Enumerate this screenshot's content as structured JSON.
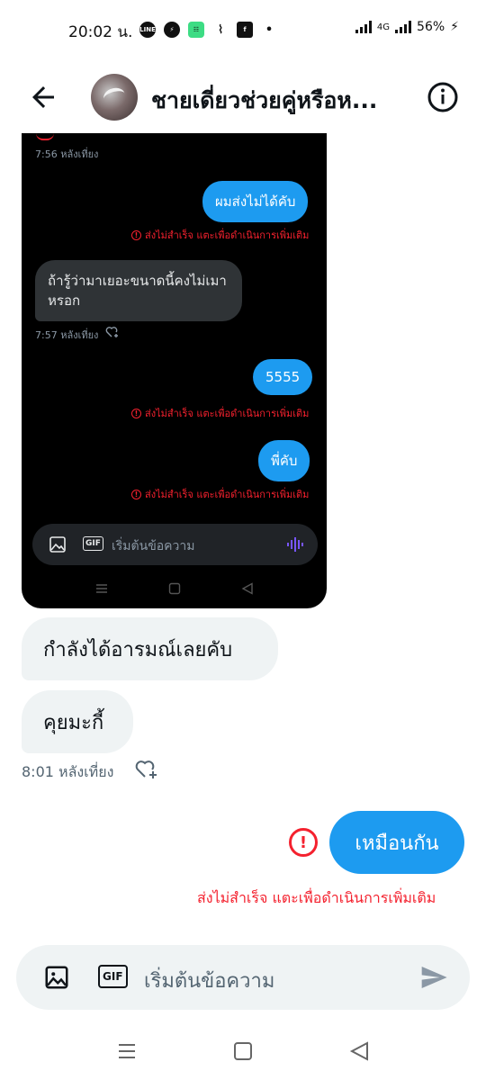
{
  "status_bar": {
    "time": "20:02 น.",
    "battery": "56%",
    "network": "4G",
    "icons": [
      "line-icon",
      "messenger-icon",
      "app-icon",
      "tail-icon",
      "facebook-icon",
      "dot-icon"
    ]
  },
  "header": {
    "title": "ชายเดี่ยวช่วยคู่หรือห..."
  },
  "embedded_screenshot": {
    "top_time": "7:56 หลังเที่ยง",
    "msg1": "ผมส่งไม่ได้คับ",
    "err": "ส่งไม่สำเร็จ แตะเพื่อดำเนินการเพิ่มเติม",
    "msg_in_line1": "ถ้ารู้ว่ามาเยอะขนาดนี้คงไม่เมา",
    "msg_in_line2": "หรอก",
    "time2": "7:57 หลังเที่ยง",
    "msg2": "5555",
    "msg3": "พี่คับ",
    "compose_placeholder": "เริ่มต้นข้อความ",
    "gif": "GIF"
  },
  "chat": {
    "in1": "กำลังได้อารมณ์เลยคับ",
    "in2": "คุยมะกี้",
    "time": "8:01 หลังเที่ยง",
    "out1": "เหมือนกัน",
    "error": "ส่งไม่สำเร็จ แตะเพื่อดำเนินการเพิ่มเติม"
  },
  "composer": {
    "placeholder": "เริ่มต้นข้อความ",
    "gif": "GIF"
  },
  "colors": {
    "accent": "#1d9bf0",
    "error": "#f4212e",
    "bubble_in": "#eff3f4"
  }
}
